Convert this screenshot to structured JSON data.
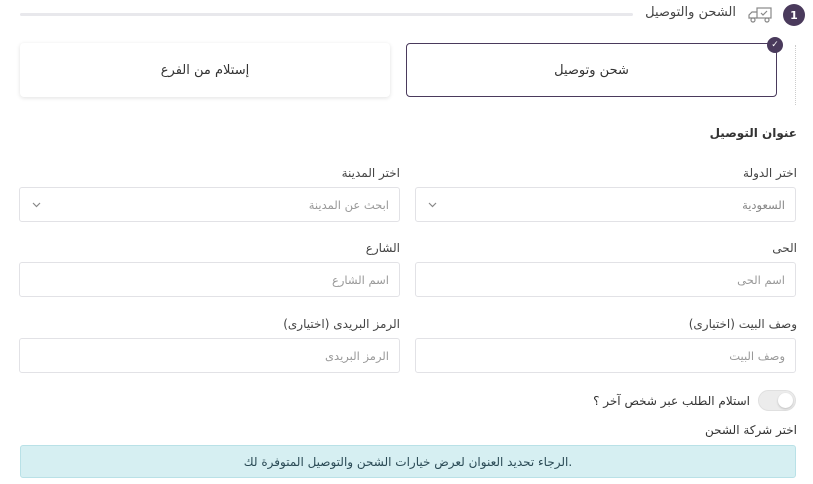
{
  "step": {
    "number": "1",
    "title": "الشحن والتوصيل",
    "icon": "truck-icon"
  },
  "methods": {
    "ship": {
      "label": "شحن وتوصيل",
      "selected": true
    },
    "pickup": {
      "label": "إستلام من الفرع",
      "selected": false
    }
  },
  "address": {
    "title": "عنوان التوصيل",
    "country": {
      "label": "اختر الدولة",
      "value": "السعودية"
    },
    "city": {
      "label": "اختر المدينة",
      "placeholder": "ابحث عن المدينة"
    },
    "district": {
      "label": "الحى",
      "placeholder": "اسم الحى"
    },
    "street": {
      "label": "الشارع",
      "placeholder": "اسم الشارع"
    },
    "house": {
      "label": "وصف البيت (اختيارى)",
      "placeholder": "وصف البيت"
    },
    "postal": {
      "label": "الرمز البريدى (اختيارى)",
      "placeholder": "الرمز البريدى"
    }
  },
  "other_person": {
    "label": "استلام الطلب عبر شخص آخر ؟",
    "on": false
  },
  "shipping_company": {
    "title": "اختر شركة الشحن",
    "notice": "الرجاء تحديد العنوان لعرض خيارات الشحن والتوصيل المتوفرة لك."
  },
  "colors": {
    "accent": "#4a3a5c",
    "alert_bg": "#d6eff2"
  }
}
